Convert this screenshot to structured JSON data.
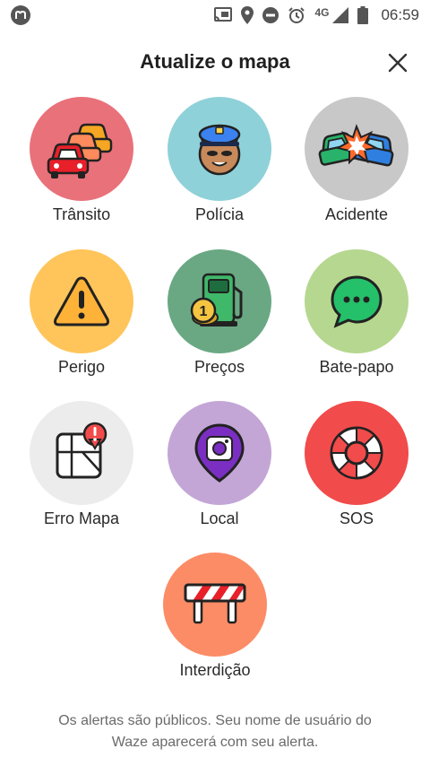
{
  "status_bar": {
    "network": "4G",
    "time": "06:59"
  },
  "header": {
    "title": "Atualize o mapa"
  },
  "tiles": [
    {
      "label": "Trânsito",
      "color": "#e9717a"
    },
    {
      "label": "Polícia",
      "color": "#8fd1d8"
    },
    {
      "label": "Acidente",
      "color": "#c8c8c8"
    },
    {
      "label": "Perigo",
      "color": "#ffc55a"
    },
    {
      "label": "Preços",
      "color": "#6aa883"
    },
    {
      "label": "Bate-papo",
      "color": "#b6d78f"
    },
    {
      "label": "Erro Mapa",
      "color": "#ececec"
    },
    {
      "label": "Local",
      "color": "#c3a6d6"
    },
    {
      "label": "SOS",
      "color": "#f14b4b"
    },
    {
      "label": "Interdição",
      "color": "#fb8c66"
    }
  ],
  "footer": {
    "line1": "Os alertas são públicos. Seu nome de usuário do",
    "line2": "Waze aparecerá com seu alerta."
  }
}
